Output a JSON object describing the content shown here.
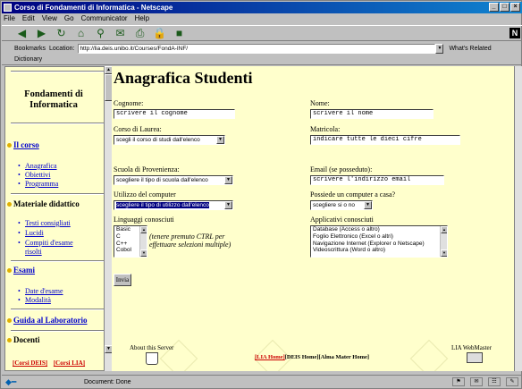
{
  "window": {
    "title": "Corso di Fondamenti di Informatica - Netscape"
  },
  "menu": [
    "File",
    "Edit",
    "View",
    "Go",
    "Communicator",
    "Help"
  ],
  "location": {
    "bookmarks_label": "Bookmarks",
    "location_label": "Location:",
    "url": "http://lia.deis.unibo.it/Courses/FondA-INF/",
    "related_label": "What's Related"
  },
  "personal_toolbar": {
    "item": "Dictionary"
  },
  "sidebar": {
    "title_line1": "Fondamenti di",
    "title_line2": "Informatica",
    "sections": [
      {
        "label": "Il corso",
        "items": [
          "Anagrafica",
          "Obiettivi",
          "Programma"
        ]
      },
      {
        "label": "Materiale didattico",
        "items": [
          "Testi consigliati",
          "Lucidi",
          "Compiti d'esame",
          "risolti"
        ]
      },
      {
        "label": "Esami",
        "items": [
          "Date d'esame",
          "Modalità"
        ]
      },
      {
        "label": "Guida al Laboratorio",
        "items": []
      },
      {
        "label": "Docenti",
        "items": []
      }
    ],
    "footer_links": [
      "[Corsi DEIS]",
      "[Corsi LIA]"
    ]
  },
  "form": {
    "title": "Anagrafica Studenti",
    "cognome": {
      "label": "Cognome:",
      "value": "scrivere il cognome"
    },
    "nome": {
      "label": "Nome:",
      "value": "scrivere il nome"
    },
    "corso": {
      "label": "Corso di Laurea:",
      "value": "scegli il corso di studi dall'elenco"
    },
    "matricola": {
      "label": "Matricola:",
      "value": "indicare tutte le dieci cifre"
    },
    "scuola": {
      "label": "Scuola di Provenienza:",
      "value": "scegliere il tipo di scuola dall'elenco"
    },
    "email": {
      "label": "Email (se posseduto):",
      "value": "scrivere l'indirizzo email"
    },
    "utilizzo": {
      "label": "Utilizzo del computer",
      "value": "scegliere il tipo di utilizzo dall'elenco"
    },
    "possiede": {
      "label": "Possiede un computer a casa?",
      "value": "scegliere si o no"
    },
    "linguaggi": {
      "label": "Linguaggi conosciuti",
      "options": [
        "Basic",
        "C",
        "C++",
        "Cobol"
      ]
    },
    "hint_line1": "(tenere premuto CTRL per",
    "hint_line2": "effettuare selezioni multiple)",
    "applicativi": {
      "label": "Applicativi conosciuti",
      "options": [
        "Database (Access o altro)",
        "Foglio Elettronico (Excel o altri)",
        "Navigazione Internet (Explorer o Netscape)",
        "Videoscrittura (Word o altro)"
      ]
    },
    "submit_label": "Invia"
  },
  "footer": {
    "about": "About this Server",
    "link_lia": "[LIA Home]",
    "link_deis": "[DEIS Home]",
    "link_alma": "[Alma Mater Home]",
    "webmaster": "LIA WebMaster"
  },
  "status": {
    "text": "Document: Done"
  },
  "colors": {
    "page_bg": "#ffffcc",
    "link": "#0000cc",
    "title_bar": "#000080",
    "footer_link_red": "#cc0000"
  }
}
